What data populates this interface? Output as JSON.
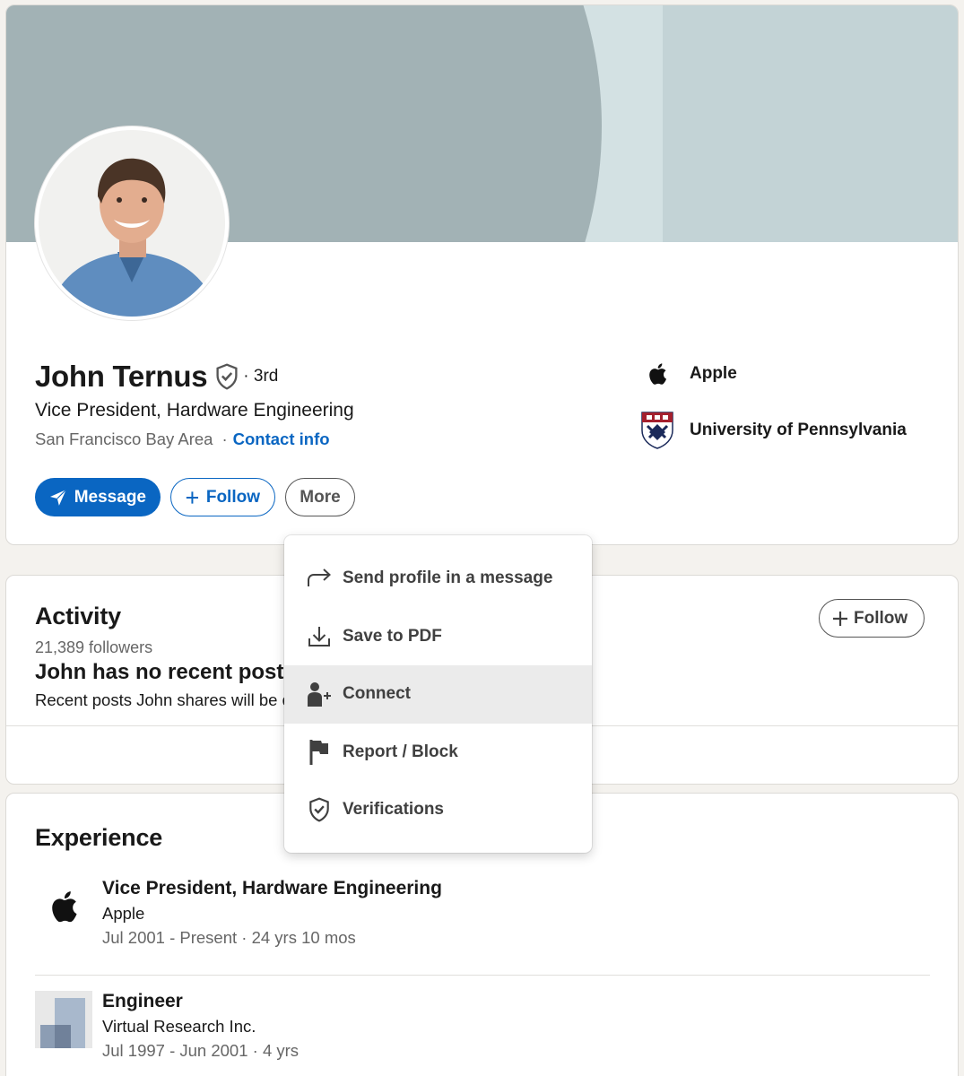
{
  "profile": {
    "name": "John Ternus",
    "degree": "· 3rd",
    "headline": "Vice President, Hardware Engineering",
    "location": "San Francisco Bay Area",
    "separator": "·",
    "contact_link": "Contact info",
    "buttons": {
      "message": "Message",
      "follow": "Follow",
      "more": "More"
    },
    "side": {
      "company": "Apple",
      "school": "University of Pennsylvania"
    }
  },
  "dropdown": {
    "items": [
      {
        "label": "Send profile in a message",
        "icon": "share-arrow-icon"
      },
      {
        "label": "Save to PDF",
        "icon": "download-icon"
      },
      {
        "label": "Connect",
        "icon": "add-person-icon",
        "highlighted": true
      },
      {
        "label": "Report / Block",
        "icon": "flag-icon"
      },
      {
        "label": "Verifications",
        "icon": "verified-shield-icon"
      }
    ]
  },
  "activity": {
    "title": "Activity",
    "followers": "21,389 followers",
    "empty_title": "John has no recent posts",
    "empty_note": "Recent posts John shares will be displayed here.",
    "follow_button": "Follow"
  },
  "experience": {
    "title": "Experience",
    "items": [
      {
        "title": "Vice President, Hardware Engineering",
        "company": "Apple",
        "dates": "Jul 2001 - Present · 24 yrs 10 mos",
        "logo": "apple-logo"
      },
      {
        "title": "Engineer",
        "company": "Virtual Research Inc.",
        "dates": "Jul 1997 - Jun 2001 · 4 yrs",
        "logo": "placeholder-company-logo"
      }
    ]
  },
  "colors": {
    "accent": "#0a66c2",
    "banner_dark": "#a2b2b5",
    "banner_light": "#d3e1e3",
    "page_bg": "#f4f2ee"
  }
}
